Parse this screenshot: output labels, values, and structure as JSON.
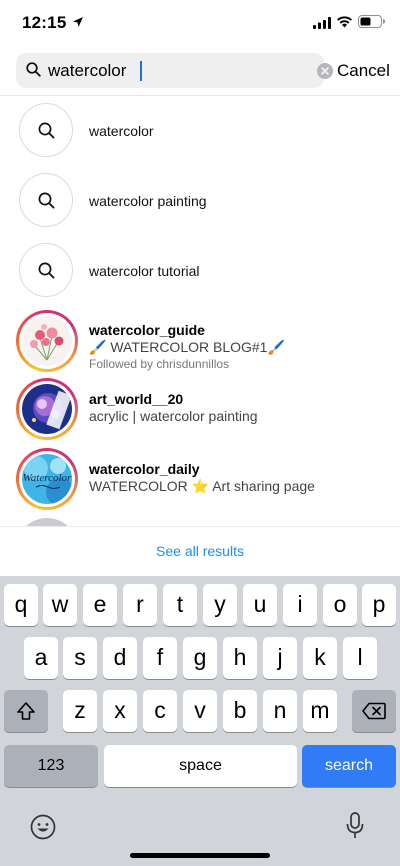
{
  "status_bar": {
    "time": "12:15"
  },
  "search": {
    "value": "watercolor",
    "cancel_label": "Cancel"
  },
  "suggestions": [
    {
      "label": "watercolor"
    },
    {
      "label": "watercolor painting"
    },
    {
      "label": "watercolor tutorial"
    }
  ],
  "accounts": [
    {
      "username": "watercolor_guide",
      "bio": "🖌️ WATERCOLOR BLOG#1🖌️",
      "followed_by": "Followed by chrisdunnillos"
    },
    {
      "username": "art_world__20",
      "bio": "acrylic | watercolor painting"
    },
    {
      "username": "watercolor_daily",
      "bio": "WATERCOLOR ⭐ Art sharing page",
      "avatar_text": "Watercolor"
    }
  ],
  "see_all_label": "See all results",
  "keyboard": {
    "row1": [
      "q",
      "w",
      "e",
      "r",
      "t",
      "y",
      "u",
      "i",
      "o",
      "p"
    ],
    "row2": [
      "a",
      "s",
      "d",
      "f",
      "g",
      "h",
      "j",
      "k",
      "l"
    ],
    "row3": [
      "z",
      "x",
      "c",
      "v",
      "b",
      "n",
      "m"
    ],
    "numbers_label": "123",
    "space_label": "space",
    "search_label": "search"
  },
  "colors": {
    "accent": "#1d8cf0",
    "search_key": "#2f7cf6",
    "keyboard_bg": "#d1d4d9"
  }
}
